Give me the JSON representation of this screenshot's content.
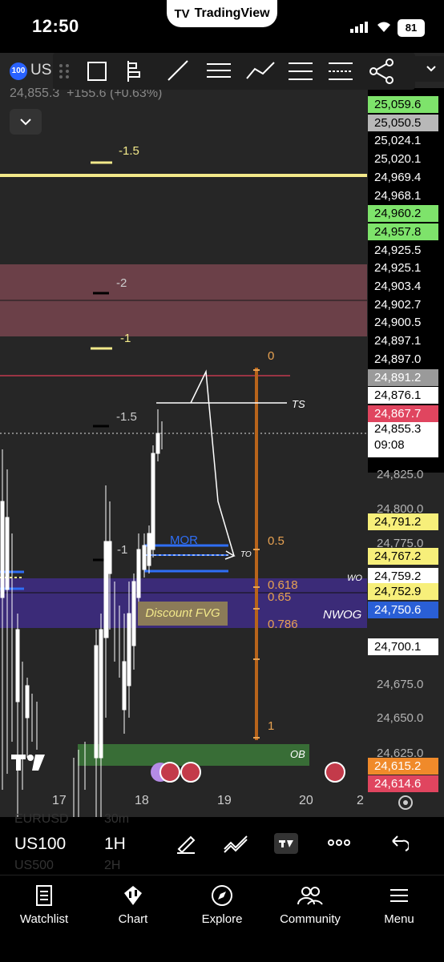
{
  "status_bar": {
    "time": "12:50",
    "app_name": "TradingView",
    "battery": "81"
  },
  "symbol_header": {
    "badge": "100",
    "symbol_partial": "US",
    "price_line": "24,855.3  +155.6 (+0.63%)"
  },
  "price_labels": [
    {
      "text": "25,059.6",
      "bg": "#7ee36b",
      "fg": "#000"
    },
    {
      "text": "25,050.5",
      "bg": "#b8b8b8",
      "fg": "#000"
    },
    {
      "text": "25,024.1",
      "bg": "#000",
      "fg": "#fff"
    },
    {
      "text": "25,020.1",
      "bg": "#000",
      "fg": "#fff"
    },
    {
      "text": "24,969.4",
      "bg": "#000",
      "fg": "#fff"
    },
    {
      "text": "24,968.1",
      "bg": "#000",
      "fg": "#fff"
    },
    {
      "text": "24,960.2",
      "bg": "#7ee36b",
      "fg": "#000"
    },
    {
      "text": "24,957.8",
      "bg": "#7ee36b",
      "fg": "#000"
    },
    {
      "text": "24,925.5",
      "bg": "#000",
      "fg": "#fff"
    },
    {
      "text": "24,925.1",
      "bg": "#000",
      "fg": "#fff"
    },
    {
      "text": "24,903.4",
      "bg": "#000",
      "fg": "#fff"
    },
    {
      "text": "24,902.7",
      "bg": "#000",
      "fg": "#fff"
    },
    {
      "text": "24,900.5",
      "bg": "#000",
      "fg": "#fff"
    },
    {
      "text": "24,897.1",
      "bg": "#000",
      "fg": "#fff"
    },
    {
      "text": "24,897.0",
      "bg": "#000",
      "fg": "#fff"
    },
    {
      "text": "24,891.2",
      "bg": "#9a9a9a",
      "fg": "#fff"
    },
    {
      "text": "24,876.1",
      "bg": "#fff",
      "fg": "#000"
    },
    {
      "text": "24,867.7",
      "bg": "#e0455f",
      "fg": "#fff"
    }
  ],
  "current_price": {
    "price": "24,855.3",
    "countdown": "09:08"
  },
  "axis_labels": [
    "24,825.0",
    "24,800.0",
    "24,775.0",
    "24,675.0",
    "24,650.0",
    "24,625.0"
  ],
  "lower_price_labels": [
    {
      "text": "24,791.2",
      "bg": "#f7ef7a",
      "fg": "#000"
    },
    {
      "text": "24,767.2",
      "bg": "#f7ef7a",
      "fg": "#000"
    },
    {
      "text": "24,759.2",
      "bg": "#fff",
      "fg": "#000"
    },
    {
      "text": "24,752.9",
      "bg": "#f7ef7a",
      "fg": "#000"
    },
    {
      "text": "24,750.6",
      "bg": "#2a5fd6",
      "fg": "#fff"
    },
    {
      "text": "24,700.1",
      "bg": "#fff",
      "fg": "#000"
    },
    {
      "text": "24,615.2",
      "bg": "#f08a2a",
      "fg": "#fff"
    },
    {
      "text": "24,614.6",
      "bg": "#e0455f",
      "fg": "#fff"
    }
  ],
  "fib_labels": [
    "0",
    "0.5",
    "0.618",
    "0.65",
    "0.786",
    "1"
  ],
  "level_labels": {
    "l1": "-1.5",
    "l2": "-2",
    "l3": "-1",
    "l4": "-1.5",
    "l5": "-1"
  },
  "annotations": {
    "ts": "TS",
    "to": "TO",
    "mor": "MOR",
    "wo": "WO",
    "nwog": "NWOG",
    "discount_fvg": "Discount FVG",
    "ob": "OB"
  },
  "time_axis": [
    "17",
    "18",
    "19",
    "20",
    "2"
  ],
  "bottom_bar": {
    "symbol": "US100",
    "interval": "1H",
    "ghost_symbol_1": "EURUSD",
    "ghost_interval_1": "30m",
    "ghost_symbol_2": "US500",
    "ghost_interval_2": "2H"
  },
  "tabs": [
    {
      "label": "Watchlist",
      "icon": "watchlist-icon"
    },
    {
      "label": "Chart",
      "icon": "chart-icon"
    },
    {
      "label": "Explore",
      "icon": "compass-icon"
    },
    {
      "label": "Community",
      "icon": "community-icon"
    },
    {
      "label": "Menu",
      "icon": "menu-icon"
    }
  ],
  "colors": {
    "background": "#262626",
    "yellow_line": "#f3e98a",
    "pink_zone": "#6b4048",
    "purple_zone": "#3b2b78",
    "fib_line": "#b8641b",
    "ob_zone": "#3c7a3a",
    "blue_ray": "#2f6ef5"
  }
}
